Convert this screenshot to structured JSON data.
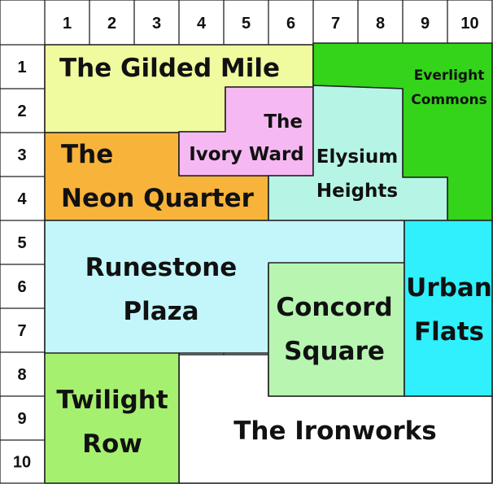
{
  "grid": {
    "columns": [
      "1",
      "2",
      "3",
      "4",
      "5",
      "6",
      "7",
      "8",
      "9",
      "10"
    ],
    "rows": [
      "1",
      "2",
      "3",
      "4",
      "5",
      "6",
      "7",
      "8",
      "9",
      "10"
    ]
  },
  "regions": [
    {
      "id": "gilded-mile",
      "label_lines": [
        "The Gilded Mile"
      ],
      "color": "#f0fa9e"
    },
    {
      "id": "everlight",
      "label_lines": [
        "Everlight",
        "Commons"
      ],
      "color": "#33d419"
    },
    {
      "id": "neon-quarter",
      "label_lines": [
        "The",
        "Neon Quarter"
      ],
      "color": "#f8b33a"
    },
    {
      "id": "ivory-ward",
      "label_lines": [
        "The",
        "Ivory Ward"
      ],
      "color": "#f6b8f2"
    },
    {
      "id": "elysium",
      "label_lines": [
        "Elysium",
        "Heights"
      ],
      "color": "#b6f5e6"
    },
    {
      "id": "runestone",
      "label_lines": [
        "Runestone",
        "Plaza"
      ],
      "color": "#c3f6fb"
    },
    {
      "id": "concord",
      "label_lines": [
        "Concord",
        "Square"
      ],
      "color": "#b7f5b1"
    },
    {
      "id": "urban-flats",
      "label_lines": [
        "Urban",
        "Flats"
      ],
      "color": "#2ff0fc"
    },
    {
      "id": "twilight-row",
      "label_lines": [
        "Twilight",
        "Row"
      ],
      "color": "#a6f070"
    },
    {
      "id": "ironworks",
      "label_lines": [
        "The Ironworks"
      ],
      "color": "#ffffff"
    }
  ]
}
